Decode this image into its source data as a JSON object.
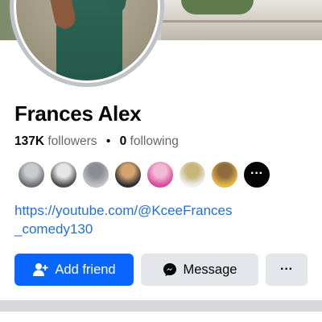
{
  "profile": {
    "name": "Frances Alex",
    "followers_count": "137K",
    "followers_label": "followers",
    "separator": "•",
    "following_count": "0",
    "following_label": "following",
    "link_line1": "https://youtube.com/@KceeFrances",
    "link_line2": "_comedy130"
  },
  "mutual_friends": {
    "avatars": [
      {
        "colors": [
          "#6d6f73",
          "#c9cbcf"
        ]
      },
      {
        "colors": [
          "#4a4c50",
          "#e6e6e6"
        ]
      },
      {
        "colors": [
          "#c0c2c5",
          "#8a8d92"
        ]
      },
      {
        "colors": [
          "#2c2d30",
          "#d6a36f"
        ]
      },
      {
        "colors": [
          "#d64a9c",
          "#f2b9d7"
        ]
      },
      {
        "colors": [
          "#f0f0f0",
          "#c7b57a"
        ]
      },
      {
        "colors": [
          "#e6b84a",
          "#8d6b3d"
        ]
      }
    ],
    "more_label": "···"
  },
  "actions": {
    "add_friend_label": "Add friend",
    "message_label": "Message",
    "more_label": "···"
  },
  "colors": {
    "primary": "#0866ff",
    "link": "#216fdb",
    "secondary_button": "#e4e6eb"
  },
  "icons": {
    "add_friend": "add-person-icon",
    "message": "messenger-icon"
  }
}
